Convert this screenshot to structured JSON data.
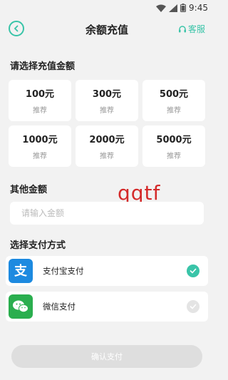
{
  "status_bar": {
    "time": "9:45"
  },
  "header": {
    "title": "余额充值",
    "service_label": "客服"
  },
  "amount_section": {
    "label": "请选择充值金额",
    "options": [
      {
        "value": "100元",
        "tag": "推荐"
      },
      {
        "value": "300元",
        "tag": "推荐"
      },
      {
        "value": "500元",
        "tag": "推荐"
      },
      {
        "value": "1000元",
        "tag": "推荐"
      },
      {
        "value": "2000元",
        "tag": "推荐"
      },
      {
        "value": "5000元",
        "tag": "推荐"
      }
    ]
  },
  "other_section": {
    "label": "其他金额",
    "placeholder": "请输入金额",
    "value": ""
  },
  "watermark": "qqtf",
  "payment_section": {
    "label": "选择支付方式",
    "methods": [
      {
        "name": "支付宝支付",
        "icon": "alipay-icon",
        "selected": true
      },
      {
        "name": "微信支付",
        "icon": "wechat-icon",
        "selected": false
      }
    ]
  },
  "confirm_button": {
    "label": "确认支付"
  },
  "colors": {
    "accent": "#39c4a8",
    "alipay": "#1d8ae0",
    "wechat": "#2aae4e"
  }
}
